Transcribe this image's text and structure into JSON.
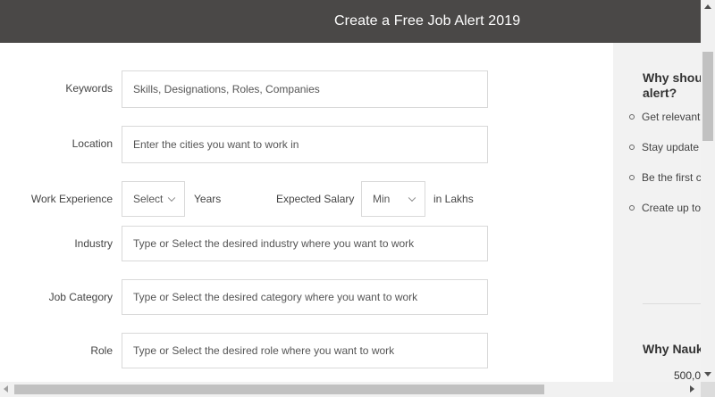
{
  "header": {
    "title": "Create a Free Job Alert 2019"
  },
  "form": {
    "keywords": {
      "label": "Keywords",
      "placeholder": "Skills, Designations, Roles, Companies"
    },
    "location": {
      "label": "Location",
      "placeholder": "Enter the cities you want to work in"
    },
    "work_experience": {
      "label": "Work Experience",
      "value": "Select",
      "unit": "Years"
    },
    "expected_salary": {
      "label": "Expected Salary",
      "value": "Min",
      "unit": "in Lakhs"
    },
    "industry": {
      "label": "Industry",
      "placeholder": "Type or Select the desired industry where you want to work"
    },
    "job_category": {
      "label": "Job Category",
      "placeholder": "Type or Select the desired category where you want to work"
    },
    "role": {
      "label": "Role",
      "placeholder": "Type or Select the desired role where you want to work"
    }
  },
  "sidebar": {
    "title": "Why shoul alert?",
    "title_line1": "Why shoul",
    "title_line2": "alert?",
    "items": [
      "Get relevant",
      "Stay update",
      "Be the first c",
      "Create up to"
    ],
    "section2_title": "Why Nauk",
    "section2_count": "500,0"
  },
  "icons": {
    "dropdown": "chevron-down-icon",
    "bullet": "circle-bullet-icon"
  },
  "colors": {
    "header_bg": "#4a4847",
    "sidebar_bg": "#f2f2f2",
    "field_border": "#d9d9d9"
  }
}
